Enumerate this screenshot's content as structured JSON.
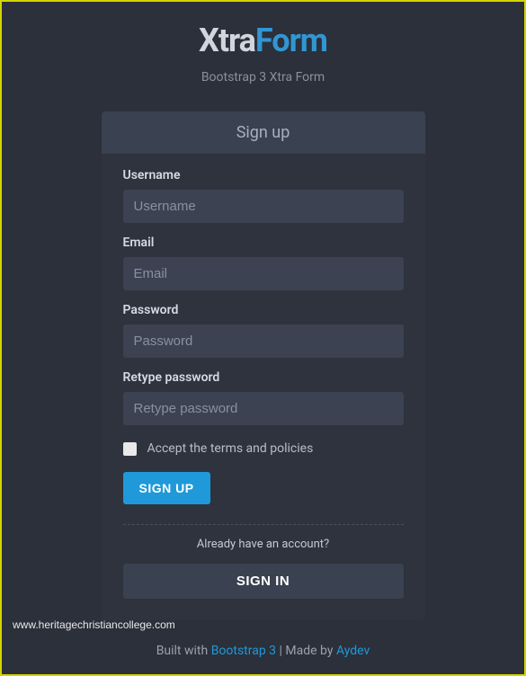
{
  "header": {
    "logo_part1": "Xtra",
    "logo_part2": "Form",
    "subtitle": "Bootstrap 3 Xtra Form"
  },
  "panel": {
    "title": "Sign up",
    "fields": {
      "username": {
        "label": "Username",
        "placeholder": "Username"
      },
      "email": {
        "label": "Email",
        "placeholder": "Email"
      },
      "password": {
        "label": "Password",
        "placeholder": "Password"
      },
      "retype": {
        "label": "Retype password",
        "placeholder": "Retype password"
      }
    },
    "terms_label": "Accept the terms and policies",
    "signup_button": "SIGN UP",
    "already_text": "Already have an account?",
    "signin_button": "SIGN IN"
  },
  "watermark": "www.heritagechristiancollege.com",
  "footer": {
    "built_with": "Built with ",
    "bootstrap_link": "Bootstrap 3",
    "separator": " | Made by ",
    "aydev_link": "Aydev"
  }
}
